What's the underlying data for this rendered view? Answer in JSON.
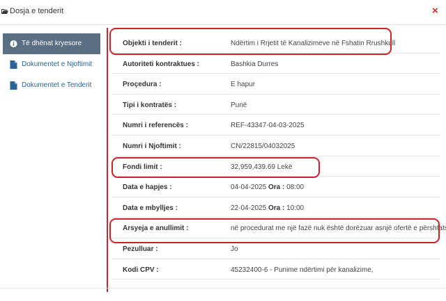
{
  "modal": {
    "title": "Dosja e tenderit",
    "close_symbol": "×"
  },
  "sidebar": {
    "items": [
      {
        "label": "Të dhënat kryesore",
        "icon": "info-circle-icon",
        "active": true
      },
      {
        "label": "Dokumentet e Njoftimit",
        "icon": "document-icon",
        "active": false
      },
      {
        "label": "Dokumentet e Tenderit",
        "icon": "document-icon",
        "active": false
      }
    ]
  },
  "details": {
    "rows": [
      {
        "label": "Objekti i tenderit :",
        "value": "Ndërtim i Rrjetit të Kanalizimeve në Fshatin Rrushkull",
        "highlighted": true
      },
      {
        "label": "Autoriteti kontraktues :",
        "value": "Bashkia Durres"
      },
      {
        "label": "Proçedura :",
        "value": "E hapur"
      },
      {
        "label": "Tipi i kontratës :",
        "value": "Punë"
      },
      {
        "label": "Numri i referencës :",
        "value": "REF-43347-04-03-2025"
      },
      {
        "label": "Numri i Njoftimit :",
        "value": "CN/22815/04032025"
      },
      {
        "label": "Fondi limit :",
        "value": "32,959,439.69 Lekë",
        "highlighted": true
      },
      {
        "label": "Data e hapjes :",
        "value": "04-04-2025",
        "time_label": "Ora :",
        "time": "08:00"
      },
      {
        "label": "Data e mbylljes :",
        "value": "22-04-2025",
        "time_label": "Ora :",
        "time": "10:00"
      },
      {
        "label": "Arsyeja e anullimit :",
        "value": "në procedurat me një fazë nuk është dorëzuar asnjë ofertë e përshtatshme",
        "highlighted": true
      },
      {
        "label": "Pezulluar :",
        "value": "Jo"
      },
      {
        "label": "Kodi CPV :",
        "value": "45232400-6 - Punime ndërtimi për kanalizime,"
      }
    ]
  },
  "colors": {
    "sidebar_active_bg": "#5b6f82",
    "link": "#2a6496",
    "highlight_red": "#d21f2a",
    "close_red": "#d9242a"
  }
}
